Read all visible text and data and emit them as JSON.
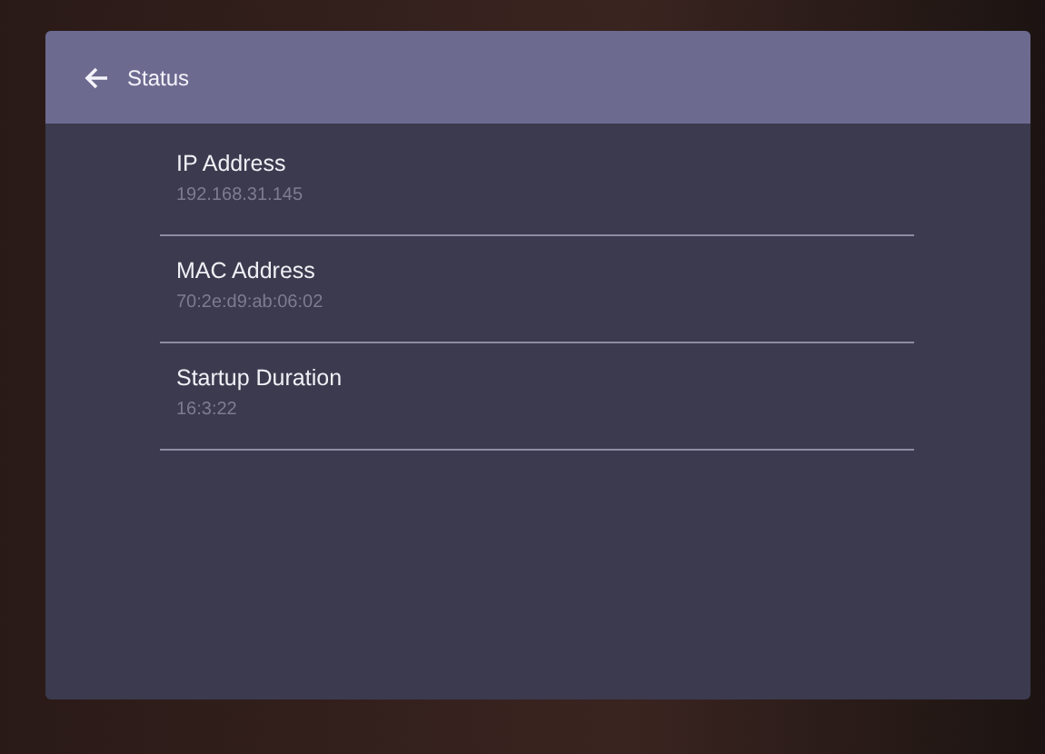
{
  "header": {
    "title": "Status"
  },
  "items": [
    {
      "label": "IP Address",
      "value": "192.168.31.145"
    },
    {
      "label": "MAC Address",
      "value": "70:2e:d9:ab:06:02"
    },
    {
      "label": "Startup Duration",
      "value": "16:3:22"
    }
  ]
}
